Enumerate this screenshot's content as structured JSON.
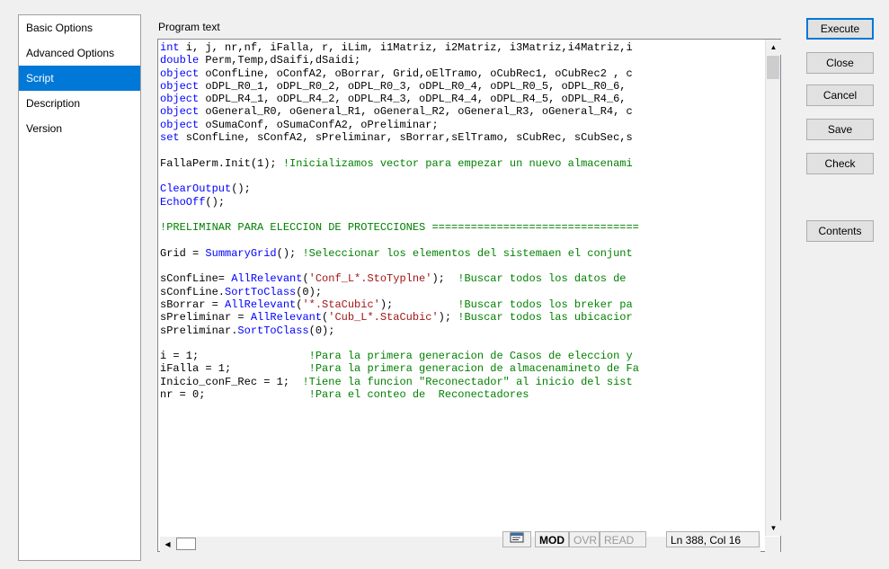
{
  "sidebar": {
    "items": [
      {
        "label": "Basic Options"
      },
      {
        "label": "Advanced Options"
      },
      {
        "label": "Script"
      },
      {
        "label": "Description"
      },
      {
        "label": "Version"
      }
    ],
    "selected": "Script"
  },
  "editor": {
    "label": "Program text",
    "lines": [
      [
        [
          "kw",
          "int"
        ],
        [
          "t",
          " i, j, nr,nf, iFalla, r, iLim, i1Matriz, i2Matriz, i3Matriz,i4Matriz,i"
        ]
      ],
      [
        [
          "kw",
          "double"
        ],
        [
          "t",
          " Perm,Temp,dSaifi,dSaidi;"
        ]
      ],
      [
        [
          "kw",
          "object"
        ],
        [
          "t",
          " oConfLine, oConfA2, oBorrar, Grid,oElTramo, oCubRec1, oCubRec2 , c"
        ]
      ],
      [
        [
          "kw",
          "object"
        ],
        [
          "t",
          " oDPL_R0_1, oDPL_R0_2, oDPL_R0_3, oDPL_R0_4, oDPL_R0_5, oDPL_R0_6,"
        ]
      ],
      [
        [
          "kw",
          "object"
        ],
        [
          "t",
          " oDPL_R4_1, oDPL_R4_2, oDPL_R4_3, oDPL_R4_4, oDPL_R4_5, oDPL_R4_6,"
        ]
      ],
      [
        [
          "kw",
          "object"
        ],
        [
          "t",
          " oGeneral_R0, oGeneral_R1, oGeneral_R2, oGeneral_R3, oGeneral_R4, c"
        ]
      ],
      [
        [
          "kw",
          "object"
        ],
        [
          "t",
          " oSumaConf, oSumaConfA2, oPreliminar;"
        ]
      ],
      [
        [
          "kw",
          "set"
        ],
        [
          "t",
          " sConfLine, sConfA2, sPreliminar, sBorrar,sElTramo, sCubRec, sCubSec,s"
        ]
      ],
      [],
      [
        [
          "t",
          "FallaPerm.Init(1); "
        ],
        [
          "cm",
          "!Inicializamos vector para empezar un nuevo almacenami"
        ]
      ],
      [],
      [
        [
          "fn",
          "ClearOutput"
        ],
        [
          "t",
          "();"
        ]
      ],
      [
        [
          "fn",
          "EchoOff"
        ],
        [
          "t",
          "();"
        ]
      ],
      [],
      [
        [
          "cm",
          "!PRELIMINAR PARA ELECCION DE PROTECCIONES ================================"
        ]
      ],
      [],
      [
        [
          "t",
          "Grid = "
        ],
        [
          "fn",
          "SummaryGrid"
        ],
        [
          "t",
          "(); "
        ],
        [
          "cm",
          "!Seleccionar los elementos del sistemaen el conjunt"
        ]
      ],
      [],
      [
        [
          "t",
          "sConfLine= "
        ],
        [
          "fn",
          "AllRelevant"
        ],
        [
          "t",
          "("
        ],
        [
          "str",
          "'Conf_L*.StoTyplne'"
        ],
        [
          "t",
          ");  "
        ],
        [
          "cm",
          "!Buscar todos los datos de"
        ]
      ],
      [
        [
          "t",
          "sConfLine."
        ],
        [
          "fn",
          "SortToClass"
        ],
        [
          "t",
          "(0);"
        ]
      ],
      [
        [
          "t",
          "sBorrar = "
        ],
        [
          "fn",
          "AllRelevant"
        ],
        [
          "t",
          "("
        ],
        [
          "str",
          "'*.StaCubic'"
        ],
        [
          "t",
          ");          "
        ],
        [
          "cm",
          "!Buscar todos los breker pa"
        ]
      ],
      [
        [
          "t",
          "sPreliminar = "
        ],
        [
          "fn",
          "AllRelevant"
        ],
        [
          "t",
          "("
        ],
        [
          "str",
          "'Cub_L*.StaCubic'"
        ],
        [
          "t",
          "); "
        ],
        [
          "cm",
          "!Buscar todos las ubicacior"
        ]
      ],
      [
        [
          "t",
          "sPreliminar."
        ],
        [
          "fn",
          "SortToClass"
        ],
        [
          "t",
          "(0);"
        ]
      ],
      [],
      [
        [
          "t",
          "i = 1;                 "
        ],
        [
          "cm",
          "!Para la primera generacion de Casos de eleccion y"
        ]
      ],
      [
        [
          "t",
          "iFalla = 1;            "
        ],
        [
          "cm",
          "!Para la primera generacion de almacenamineto de Fa"
        ]
      ],
      [
        [
          "t",
          "Inicio_conF_Rec = 1;  "
        ],
        [
          "cm",
          "!Tiene la funcion \"Reconectador\" al inicio del sist"
        ]
      ],
      [
        [
          "t",
          "nr = 0;                "
        ],
        [
          "cm",
          "!Para el conteo de  Reconectadores"
        ]
      ]
    ]
  },
  "status": {
    "icon": "note-icon",
    "mod": "MOD",
    "ovr": "OVR",
    "read": "READ",
    "position": "Ln 388, Col 16"
  },
  "buttons": {
    "execute": "Execute",
    "close": "Close",
    "cancel": "Cancel",
    "save": "Save",
    "check": "Check",
    "contents": "Contents"
  },
  "colors": {
    "selection": "#0078d7",
    "keyword": "#0000ff",
    "comment": "#008000",
    "string": "#a31515"
  }
}
